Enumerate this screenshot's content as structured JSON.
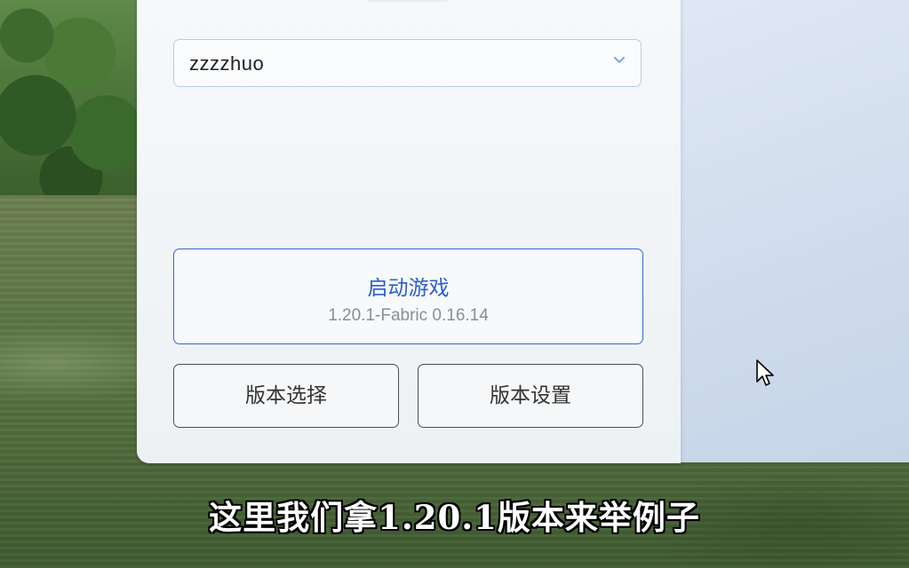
{
  "launcher": {
    "account": {
      "selected": "zzzzhuo",
      "icon": "chevron-down-icon"
    },
    "launch": {
      "title": "启动游戏",
      "version": "1.20.1-Fabric 0.16.14"
    },
    "buttons": {
      "version_select": "版本选择",
      "version_settings": "版本设置"
    }
  },
  "subtitle": "这里我们拿1.20.1版本来举例子",
  "colors": {
    "accent": "#2e6bd1",
    "accent_text": "#2a5fc4",
    "select_border": "#b9cce4"
  }
}
